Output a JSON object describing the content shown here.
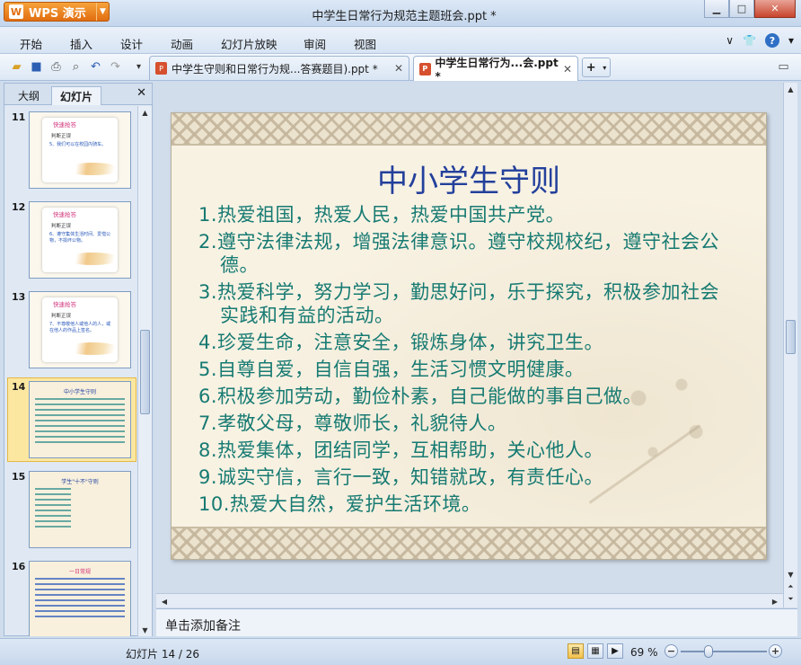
{
  "app": {
    "brand": "WPS 演示",
    "window_title": "中学生日常行为规范主题班会.ppt *"
  },
  "menu": [
    "开始",
    "插入",
    "设计",
    "动画",
    "幻灯片放映",
    "审阅",
    "视图"
  ],
  "doc_tabs": [
    {
      "label": "中学生守则和日常行为规...答赛题目).ppt *"
    },
    {
      "label": "中学生日常行为...会.ppt *"
    }
  ],
  "panel": {
    "tabs": [
      "大纲",
      "幻灯片"
    ]
  },
  "thumbnails": [
    {
      "num": "11",
      "head": "快速抢答",
      "sub": "判断正误",
      "line": "5、我们可以在校园内骑车。"
    },
    {
      "num": "12",
      "head": "快速抢答",
      "sub": "判断正误",
      "line": "6、遵守集体生活时间、爱惜公物，不损坏公物。"
    },
    {
      "num": "13",
      "head": "快速抢答",
      "sub": "判断正误",
      "line": "7、不尊敬他人或他人的人，或在他人的作品上签名。"
    },
    {
      "num": "14",
      "title": "中小学生守则"
    },
    {
      "num": "15",
      "title": "学生\"十不\"守则"
    },
    {
      "num": "16",
      "title": "一日常规"
    }
  ],
  "slide": {
    "title": "中小学生守则",
    "items": [
      "1.热爱祖国，热爱人民，热爱中国共产党。",
      "2.遵守法律法规，增强法律意识。遵守校规校纪，遵守社会公德。",
      "3.热爱科学，努力学习，勤思好问，乐于探究，积极参加社会实践和有益的活动。",
      "4.珍爱生命，注意安全，锻炼身体，讲究卫生。",
      "5.自尊自爱，自信自强，生活习惯文明健康。",
      "6.积极参加劳动，勤俭朴素，自己能做的事自己做。",
      "7.孝敬父母，尊敬师长，礼貌待人。",
      "8.热爱集体，团结同学，互相帮助，关心他人。",
      "9.诚实守信，言行一致，知错就改，有责任心。",
      "10.热爱大自然，爱护生活环境。"
    ]
  },
  "notes_placeholder": "单击添加备注",
  "status": {
    "slide_info": "幻灯片 14 / 26",
    "zoom": "69 %"
  },
  "colors": {
    "slide_title": "#23409b",
    "slide_text": "#167a72",
    "brand_orange": "#e16d10"
  }
}
